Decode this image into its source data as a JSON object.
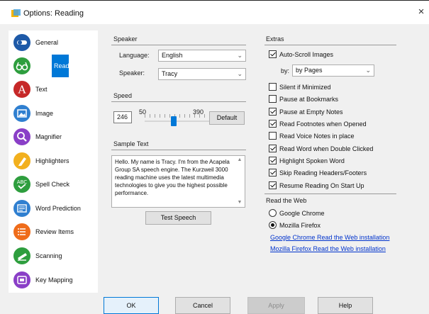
{
  "window": {
    "title": "Options: Reading",
    "close_glyph": "×"
  },
  "sidebar": {
    "items": [
      {
        "label": "General",
        "icon": "toggle-icon",
        "color": "#1e5aa8"
      },
      {
        "label": "Reading",
        "icon": "glasses-icon",
        "color": "#2e9e3e",
        "selected": true
      },
      {
        "label": "Text",
        "icon": "letter-a-icon",
        "color": "#c62828"
      },
      {
        "label": "Image",
        "icon": "image-icon",
        "color": "#2f7fd0"
      },
      {
        "label": "Magnifier",
        "icon": "magnifier-icon",
        "color": "#8a3fc7"
      },
      {
        "label": "Highlighters",
        "icon": "highlighter-icon",
        "color": "#f2b01e"
      },
      {
        "label": "Spell Check",
        "icon": "abc-check-icon",
        "color": "#2e9e3e"
      },
      {
        "label": "Word Prediction",
        "icon": "word-prediction-icon",
        "color": "#2f7fd0"
      },
      {
        "label": "Review Items",
        "icon": "list-icon",
        "color": "#ef6c1a"
      },
      {
        "label": "Scanning",
        "icon": "scanner-icon",
        "color": "#2e9e3e"
      },
      {
        "label": "Key Mapping",
        "icon": "keyboard-icon",
        "color": "#8a3fc7"
      }
    ]
  },
  "speaker": {
    "group_label": "Speaker",
    "language_label": "Language:",
    "language_value": "English",
    "speaker_label": "Speaker:",
    "speaker_value": "Tracy"
  },
  "speed": {
    "group_label": "Speed",
    "value": "246",
    "min": "50",
    "max": "390",
    "default_label": "Default"
  },
  "sample": {
    "group_label": "Sample Text",
    "text": "Hello. My name is Tracy. I'm from the Acapela Group SA speech engine. The Kurzweil 3000 reading machine uses the latest multimedia technologies to give you the highest possible performance.",
    "test_label": "Test Speech"
  },
  "extras": {
    "group_label": "Extras",
    "by_label": "by:",
    "by_value": "by Pages",
    "options": [
      {
        "label": "Auto-Scroll Images",
        "checked": true
      },
      {
        "label": "Silent if Minimized",
        "checked": false
      },
      {
        "label": "Pause at Bookmarks",
        "checked": false
      },
      {
        "label": "Pause at Empty Notes",
        "checked": true
      },
      {
        "label": "Read Footnotes when Opened",
        "checked": true
      },
      {
        "label": "Read Voice Notes in place",
        "checked": false
      },
      {
        "label": "Read Word when Double Clicked",
        "checked": true
      },
      {
        "label": "Highlight Spoken Word",
        "checked": true
      },
      {
        "label": "Skip Reading Headers/Footers",
        "checked": true
      },
      {
        "label": "Resume Reading On Start Up",
        "checked": true
      }
    ]
  },
  "web": {
    "group_label": "Read the Web",
    "chrome_label": "Google Chrome",
    "firefox_label": "Mozilla Firefox",
    "selected": "firefox",
    "chrome_link": "Google Chrome Read the Web installation",
    "firefox_link": "Mozilla Firefox Read the Web installation"
  },
  "buttons": {
    "ok": "OK",
    "cancel": "Cancel",
    "apply": "Apply",
    "help": "Help"
  },
  "colors": {
    "accent": "#0078d7",
    "link": "#0033cc"
  }
}
